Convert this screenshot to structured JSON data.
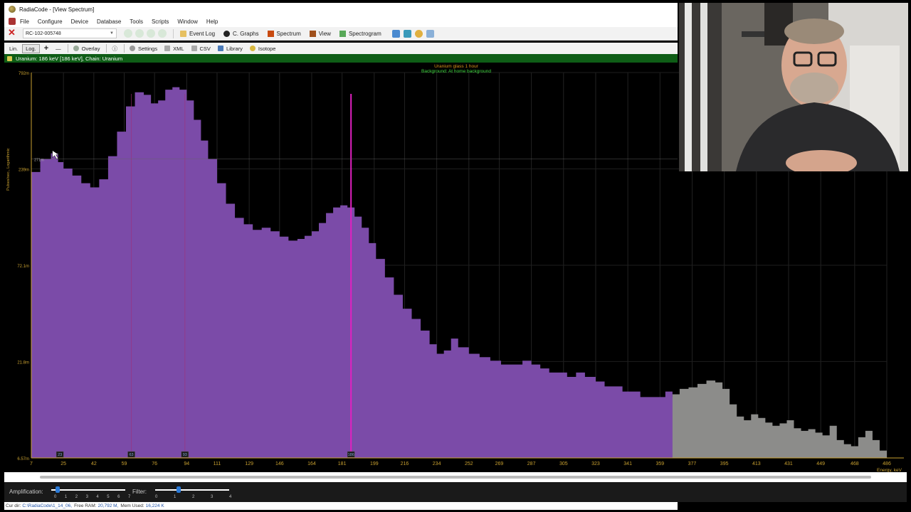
{
  "window": {
    "title": "RadiaCode - [View Spectrum]"
  },
  "menu": {
    "items": [
      "File",
      "Configure",
      "Device",
      "Database",
      "Tools",
      "Scripts",
      "Window",
      "Help"
    ]
  },
  "toolbar": {
    "device": "RC-102-005748",
    "event_log": "Event Log",
    "c_graphs": "C. Graphs",
    "spectrum": "Spectrum",
    "view": "View",
    "spectrogram": "Spectrogram"
  },
  "toolbar2": {
    "lin": "Lin.",
    "log": "Log.",
    "plus": "+",
    "minus": "—",
    "overlay": "Overlay",
    "info": "ⓘ",
    "settings": "Settings",
    "xml": "XML",
    "csv": "CSV",
    "library": "Library",
    "isotope": "Isotope"
  },
  "status": {
    "text": "Uranium: 186 keV [186 keV], Chain: Uranium"
  },
  "chart": {
    "y_title": "Pulses/sec., Logarithmic",
    "legend_line1": "Uranium glass 1 hour",
    "legend_line2": "Background: At home background",
    "x_axis_label": "Energy, keV",
    "cursor_value": "271m",
    "markers": [
      "23",
      "63",
      "93",
      "186"
    ],
    "colors": {
      "spectrum": "#7b4ba8",
      "background": "#8c8c8a",
      "marker_line": "#e020c0",
      "axis_text": "#c8a030"
    }
  },
  "chart_data": {
    "type": "area",
    "title": "",
    "xlabel": "Energy, keV",
    "ylabel": "Pulses/sec., Logarithmic",
    "y_scale": "log",
    "ylim": [
      0.00657,
      0.792
    ],
    "x_ticks": [
      "7",
      "25",
      "42",
      "59",
      "76",
      "94",
      "111",
      "129",
      "146",
      "164",
      "181",
      "199",
      "216",
      "234",
      "252",
      "269",
      "287",
      "305",
      "323",
      "341",
      "359",
      "377",
      "395",
      "413",
      "431",
      "449",
      "468",
      "486"
    ],
    "y_ticks": [
      "792m",
      "239m",
      "72.1m",
      "21.8m",
      "6.57m"
    ],
    "peak_marker_keV": 186,
    "series": [
      {
        "x": [
          7,
          12,
          18,
          22,
          25,
          30,
          35,
          40,
          45,
          50,
          55,
          60,
          65,
          70,
          74,
          78,
          82,
          86,
          90,
          94,
          98,
          102,
          106,
          111,
          116,
          121,
          126,
          131,
          136,
          141,
          146,
          151,
          156,
          160,
          164,
          168,
          172,
          176,
          180,
          184,
          188,
          192,
          196,
          200,
          205,
          210,
          215,
          220,
          225,
          230,
          234,
          238,
          242,
          246,
          252,
          258,
          264,
          270,
          276,
          282,
          287,
          292,
          297,
          302,
          307,
          312,
          317,
          323,
          328,
          333,
          338,
          343,
          348,
          353,
          357,
          362,
          366
        ],
        "values": [
          0.23,
          0.27,
          0.29,
          0.26,
          0.24,
          0.22,
          0.2,
          0.19,
          0.21,
          0.28,
          0.38,
          0.52,
          0.62,
          0.6,
          0.54,
          0.56,
          0.64,
          0.66,
          0.64,
          0.56,
          0.44,
          0.34,
          0.27,
          0.2,
          0.155,
          0.13,
          0.12,
          0.112,
          0.115,
          0.11,
          0.103,
          0.098,
          0.1,
          0.104,
          0.11,
          0.122,
          0.138,
          0.148,
          0.152,
          0.148,
          0.132,
          0.115,
          0.095,
          0.078,
          0.062,
          0.05,
          0.042,
          0.037,
          0.032,
          0.027,
          0.024,
          0.025,
          0.029,
          0.026,
          0.024,
          0.023,
          0.022,
          0.021,
          0.021,
          0.022,
          0.021,
          0.02,
          0.019,
          0.019,
          0.018,
          0.019,
          0.018,
          0.017,
          0.016,
          0.016,
          0.015,
          0.015,
          0.014,
          0.014,
          0.014,
          0.015,
          0.014
        ]
      },
      {
        "x": [
          366,
          370,
          375,
          380,
          385,
          390,
          394,
          398,
          402,
          406,
          410,
          414,
          418,
          422,
          426,
          430,
          434,
          438,
          442,
          446,
          450,
          454,
          458,
          462,
          466,
          470,
          474,
          478,
          482
        ],
        "values": [
          0.0145,
          0.0155,
          0.0158,
          0.0165,
          0.0172,
          0.0168,
          0.0155,
          0.0128,
          0.011,
          0.0105,
          0.0113,
          0.0108,
          0.0102,
          0.0098,
          0.0101,
          0.0105,
          0.0095,
          0.0092,
          0.0094,
          0.009,
          0.0087,
          0.0098,
          0.0082,
          0.0078,
          0.0076,
          0.0085,
          0.0092,
          0.0082,
          0.0072
        ]
      }
    ]
  },
  "controls": {
    "amplification_label": "Amplification:",
    "amp_ticks": [
      "0",
      "1",
      "2",
      "3",
      "4",
      "5",
      "6",
      "7"
    ],
    "filter_label": "Filter:",
    "filter_ticks": [
      "0",
      "1",
      "2",
      "3",
      "4"
    ],
    "amp_value": 0,
    "filter_value": 1
  },
  "statusbar": {
    "cur_dir_label": "Cur dir:",
    "cur_dir": "C:\\RadiaCode\\1_14_06,",
    "free_ram_label": "Free RAM:",
    "free_ram": "20,792 M,",
    "mem_used_label": "Mem Used:",
    "mem_used": "16,224 K"
  },
  "webcam": {
    "description_icon": "webcam-person"
  }
}
